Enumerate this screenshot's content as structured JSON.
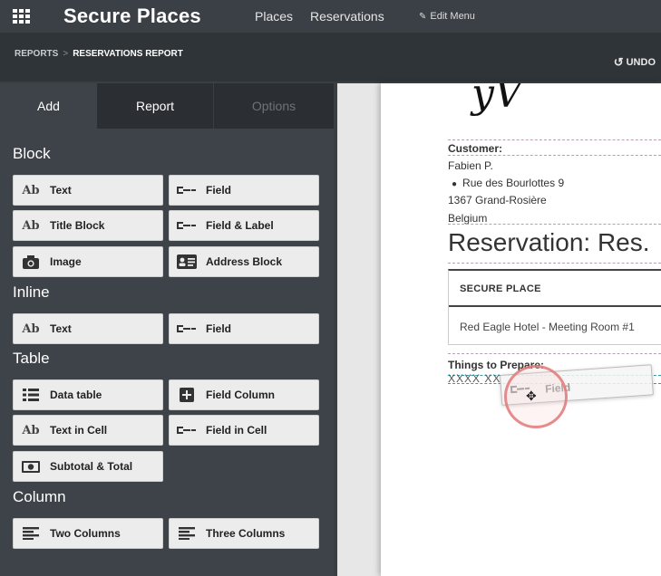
{
  "topbar": {
    "brand": "Secure Places",
    "nav": [
      "Places",
      "Reservations"
    ],
    "edit_menu": "Edit Menu"
  },
  "breadcrumb": {
    "parent": "REPORTS",
    "separator": ">",
    "current": "RESERVATIONS REPORT",
    "undo": "UNDO"
  },
  "sidebar": {
    "tabs": [
      {
        "label": "Add",
        "state": "active"
      },
      {
        "label": "Report",
        "state": "normal"
      },
      {
        "label": "Options",
        "state": "disabled"
      }
    ],
    "sections": {
      "block": "Block",
      "inline": "Inline",
      "table": "Table",
      "column": "Column"
    },
    "buttons": {
      "block_text": "Text",
      "block_field": "Field",
      "block_title": "Title Block",
      "block_field_label": "Field & Label",
      "block_image": "Image",
      "block_address": "Address Block",
      "inline_text": "Text",
      "inline_field": "Field",
      "table_data": "Data table",
      "table_field_column": "Field Column",
      "table_text_cell": "Text in Cell",
      "table_field_cell": "Field in Cell",
      "table_subtotal": "Subtotal & Total",
      "col_two": "Two Columns",
      "col_three": "Three Columns"
    },
    "ab_glyph": "Ab"
  },
  "document": {
    "customer_label": "Customer:",
    "customer_name": "Fabien P.",
    "address_line1": "Rue des Bourlottes 9",
    "address_line2": "1367 Grand-Rosière",
    "address_line3": "Belgium",
    "title": "Reservation: Res.",
    "table_header": "SECURE PLACE",
    "table_cell": "Red Eagle Hotel - Meeting Room #1",
    "things_label": "Things to Prepare:",
    "placeholder": "XXXX XX"
  },
  "drag_ghost": {
    "label": "Field"
  }
}
